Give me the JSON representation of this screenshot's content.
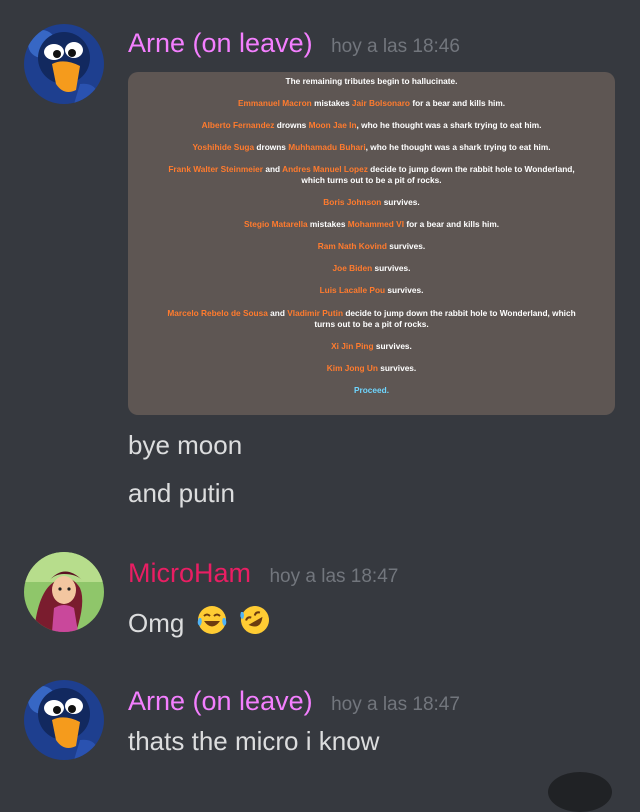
{
  "messages": [
    {
      "username": "Arne (on leave)",
      "username_color": "#f47fff",
      "timestamp": "hoy a las 18:46",
      "embed": {
        "lines": [
          [
            {
              "t": "The remaining tributes begin to hallucinate.",
              "c": "w"
            }
          ],
          [
            {
              "t": "Emmanuel Macron",
              "c": "n"
            },
            {
              "t": " mistakes ",
              "c": "w"
            },
            {
              "t": "Jair Bolsonaro",
              "c": "n"
            },
            {
              "t": " for a bear and kills him.",
              "c": "w"
            }
          ],
          [
            {
              "t": "Alberto Fernandez",
              "c": "n"
            },
            {
              "t": " drowns ",
              "c": "w"
            },
            {
              "t": "Moon Jae In",
              "c": "n"
            },
            {
              "t": ", who he thought was a shark trying to eat him.",
              "c": "w"
            }
          ],
          [
            {
              "t": "Yoshihide Suga",
              "c": "n"
            },
            {
              "t": " drowns ",
              "c": "w"
            },
            {
              "t": "Muhhamadu Buhari",
              "c": "n"
            },
            {
              "t": ", who he thought was a shark trying to eat him.",
              "c": "w"
            }
          ],
          [
            {
              "t": "Frank Walter Steinmeier",
              "c": "n"
            },
            {
              "t": " and ",
              "c": "w"
            },
            {
              "t": "Andres Manuel Lopez",
              "c": "n"
            },
            {
              "t": " decide to jump down the rabbit hole to Wonderland,",
              "c": "w"
            }
          ],
          [
            {
              "t": "which turns out to be a pit of rocks.",
              "c": "w"
            }
          ],
          [
            {
              "t": "Boris Johnson",
              "c": "n"
            },
            {
              "t": " survives.",
              "c": "w"
            }
          ],
          [
            {
              "t": "Stegio Matarella",
              "c": "n"
            },
            {
              "t": " mistakes ",
              "c": "w"
            },
            {
              "t": "Mohammed VI",
              "c": "n"
            },
            {
              "t": " for a bear and kills him.",
              "c": "w"
            }
          ],
          [
            {
              "t": "Ram Nath Kovind",
              "c": "n"
            },
            {
              "t": " survives.",
              "c": "w"
            }
          ],
          [
            {
              "t": "Joe Biden",
              "c": "n"
            },
            {
              "t": " survives.",
              "c": "w"
            }
          ],
          [
            {
              "t": "Luis Lacalle Pou",
              "c": "n"
            },
            {
              "t": " survives.",
              "c": "w"
            }
          ],
          [
            {
              "t": "Marcelo Rebelo de Sousa",
              "c": "n"
            },
            {
              "t": " and ",
              "c": "w"
            },
            {
              "t": "Vladimir Putin",
              "c": "n"
            },
            {
              "t": " decide to jump down the rabbit hole to Wonderland, which",
              "c": "w"
            }
          ],
          [
            {
              "t": "turns out to be a pit of rocks.",
              "c": "w"
            }
          ],
          [
            {
              "t": "Xi Jin Ping",
              "c": "n"
            },
            {
              "t": " survives.",
              "c": "w"
            }
          ],
          [
            {
              "t": "Kim Jong Un",
              "c": "n"
            },
            {
              "t": " survives.",
              "c": "w"
            }
          ],
          [
            {
              "t": "Proceed.",
              "c": "p"
            }
          ]
        ]
      },
      "texts": [
        "bye moon",
        "and putin"
      ]
    },
    {
      "username": "MicroHam",
      "username_color": "#e91e63",
      "timestamp": "hoy a las 18:47",
      "texts": [
        "Omg"
      ],
      "emojis": [
        "face-with-tears-of-joy",
        "rolling-on-floor-laughing"
      ]
    },
    {
      "username": "Arne (on leave)",
      "username_color": "#f47fff",
      "timestamp": "hoy a las 18:47",
      "texts": [
        "thats the micro i know"
      ]
    }
  ]
}
